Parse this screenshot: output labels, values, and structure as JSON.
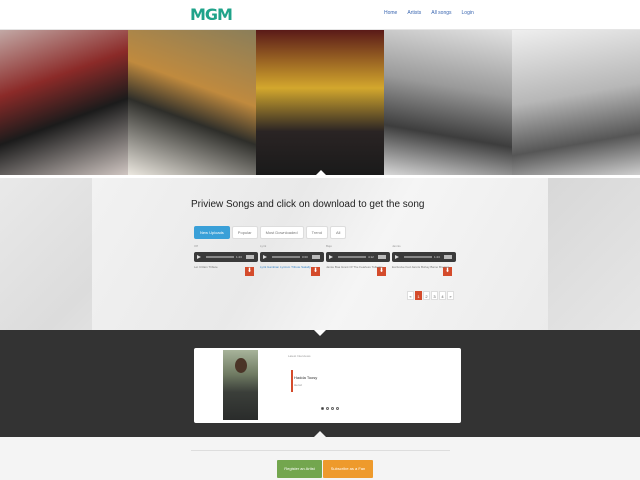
{
  "header": {
    "logo": "MGM",
    "nav": [
      "Home",
      "Artists",
      "All songs",
      "Login"
    ]
  },
  "hero": {
    "panels": [
      "hero-panel-1",
      "hero-panel-2",
      "hero-panel-3",
      "hero-panel-4",
      "hero-panel-5"
    ]
  },
  "songs": {
    "heading": "Priview Songs and click on download to get the song",
    "tabs": [
      "New Uploads",
      "Popular",
      "Most Downloaded",
      "Trend",
      "All"
    ],
    "tracks": [
      {
        "title": "Off",
        "time": "1:23",
        "desc": "Let It Rain Tribute"
      },
      {
        "title": "Lyrik",
        "time": "0:00",
        "desc": "Lyrik Gambian Lyricsm Tribute Sakally"
      },
      {
        "title": "Bajo",
        "time": "4:12",
        "desc": "Jamie Boa Grant Of The Fearless Tulleaks"
      },
      {
        "title": "Jannis",
        "time": "1:23",
        "desc": "Exclusive Fed Jannis Bohay Bamo Brenwa"
      }
    ],
    "pager": [
      "«",
      "1",
      "2",
      "3",
      "4",
      "»"
    ]
  },
  "featured": {
    "label": "Latest Interviews",
    "song_name": "Hadda Toosy",
    "song_sub": "Heroz"
  },
  "footer": {
    "register_label": "Register an Artist",
    "subscribe_label": "Subscribe as a Fan"
  },
  "colors": {
    "accent": "#3aa0d8",
    "brand": "#1fa38a",
    "download": "#d44b2b",
    "register": "#73a64e",
    "subscribe": "#ee9a2c"
  }
}
